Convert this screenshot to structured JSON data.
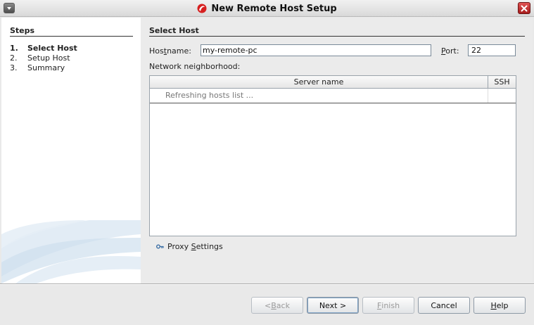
{
  "window": {
    "title": "New Remote Host Setup",
    "icon": "app-swirl-icon",
    "close_icon": "close-icon"
  },
  "steps": {
    "title": "Steps",
    "items": [
      {
        "num": "1.",
        "label": "Select Host",
        "active": true
      },
      {
        "num": "2.",
        "label": "Setup Host",
        "active": false
      },
      {
        "num": "3.",
        "label": "Summary",
        "active": false
      }
    ]
  },
  "select_host": {
    "title": "Select Host",
    "hostname_label_pre": "Hos",
    "hostname_label_u": "t",
    "hostname_label_post": "name:",
    "hostname_value": "my-remote-pc",
    "port_label_u": "P",
    "port_label_post": "ort:",
    "port_value": "22",
    "network_label": "Network neighborhood:",
    "table": {
      "columns": [
        "Server name",
        "SSH"
      ],
      "rows": [
        {
          "server": "Refreshing hosts list ...",
          "ssh": ""
        }
      ]
    },
    "proxy_pre": "Proxy ",
    "proxy_u": "S",
    "proxy_post": "ettings"
  },
  "buttons": {
    "back_pre": "< ",
    "back_u": "B",
    "back_post": "ack",
    "next": "Next >",
    "finish_u": "F",
    "finish_post": "inish",
    "cancel": "Cancel",
    "help_u": "H",
    "help_post": "elp"
  },
  "colors": {
    "close_red": "#c42b2b",
    "accent_blue": "#3a6ea5"
  }
}
